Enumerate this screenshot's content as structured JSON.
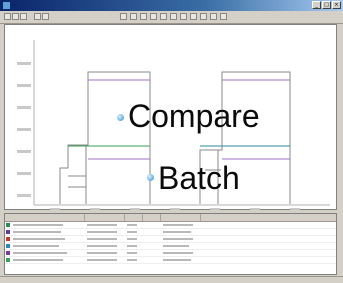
{
  "window": {
    "title": ""
  },
  "chart": {
    "title": ""
  },
  "overlay": {
    "compare_label": "Compare",
    "batch_label": "Batch"
  },
  "colors": {
    "bullet": "#6fb7e6",
    "series_purple": "#a070c8",
    "series_green": "#3aa05a",
    "series_teal": "#2a8a9a",
    "series_gray": "#8a8a8a"
  },
  "grid": {
    "row_swatches": [
      "#2e8b57",
      "#5a3fa0",
      "#c0392b",
      "#2a8ab0",
      "#7a3aa0",
      "#3aa05a"
    ]
  }
}
